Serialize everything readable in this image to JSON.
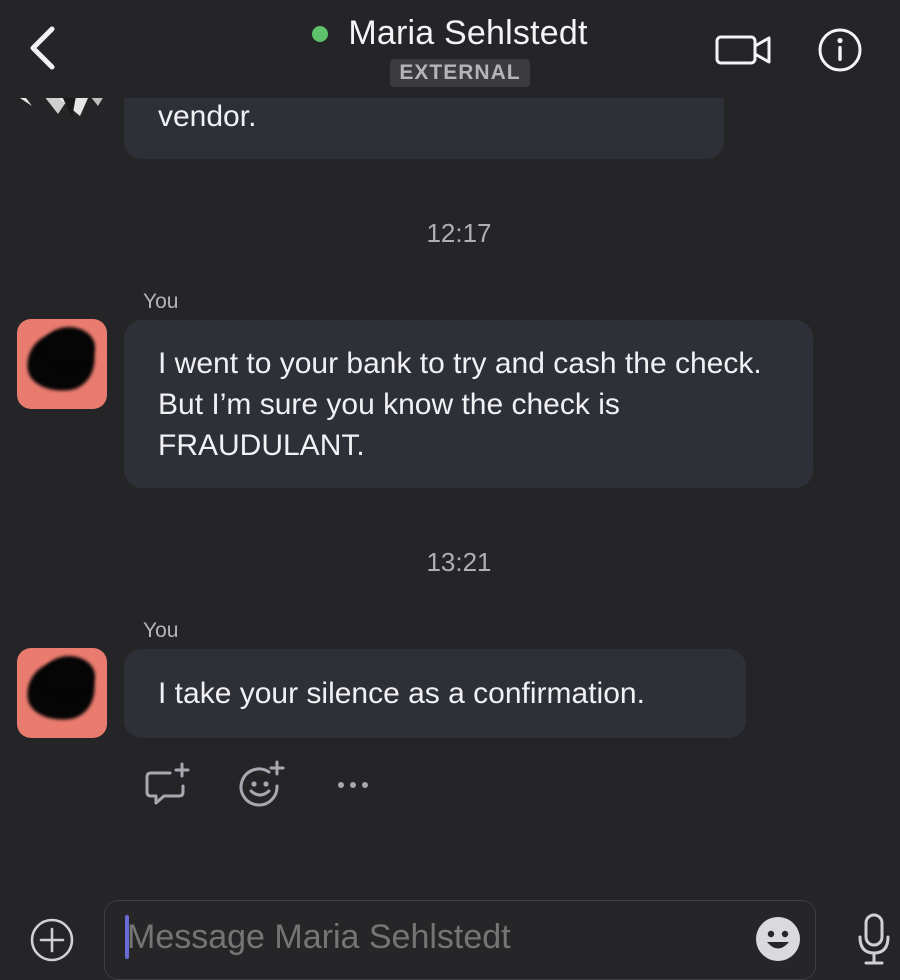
{
  "header": {
    "contact_name": "Maria Sehlstedt",
    "badge": "EXTERNAL",
    "presence_color": "#5ec26a"
  },
  "messages": {
    "previous_text": "vendor.",
    "timestamp_1": "12:17",
    "sender_1": "You",
    "message_1": "I went to your bank to try and cash the check.  But I’m sure you know the check is FRAUDULANT.",
    "timestamp_2": "13:21",
    "sender_2": "You",
    "message_2": "I take your silence as a confirmation."
  },
  "composer": {
    "placeholder": "Message Maria Sehlstedt"
  },
  "icons": [
    "back-chevron-icon",
    "video-camera-icon",
    "info-icon",
    "reply-icon",
    "add-reaction-icon",
    "more-options-icon",
    "plus-icon",
    "emoji-icon",
    "microphone-icon"
  ],
  "colors": {
    "background": "#252527",
    "bubble": "#2e3038",
    "avatar": "#ea7b6f"
  }
}
